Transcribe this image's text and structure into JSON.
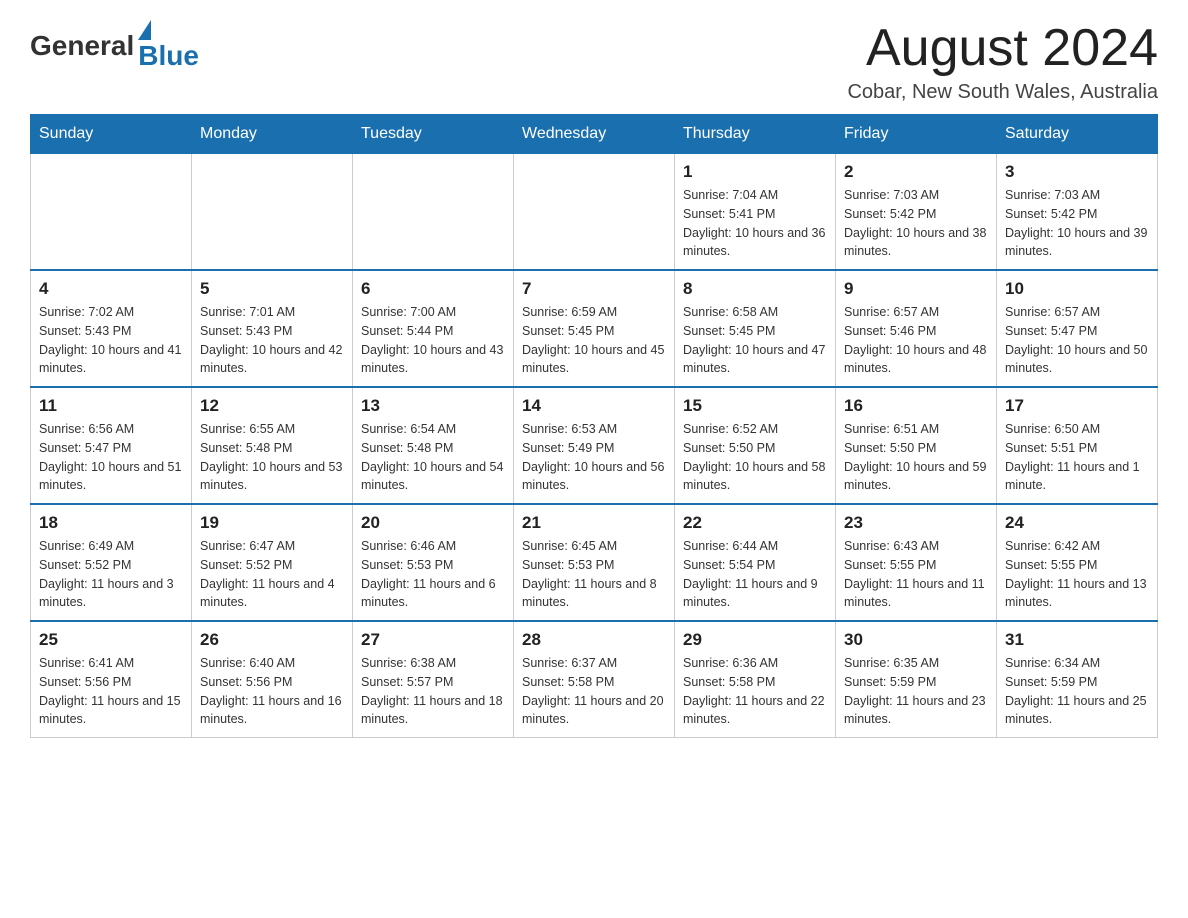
{
  "header": {
    "logo_general": "General",
    "logo_blue": "Blue",
    "month_title": "August 2024",
    "location": "Cobar, New South Wales, Australia"
  },
  "weekdays": [
    "Sunday",
    "Monday",
    "Tuesday",
    "Wednesday",
    "Thursday",
    "Friday",
    "Saturday"
  ],
  "weeks": [
    [
      {
        "day": "",
        "info": ""
      },
      {
        "day": "",
        "info": ""
      },
      {
        "day": "",
        "info": ""
      },
      {
        "day": "",
        "info": ""
      },
      {
        "day": "1",
        "info": "Sunrise: 7:04 AM\nSunset: 5:41 PM\nDaylight: 10 hours and 36 minutes."
      },
      {
        "day": "2",
        "info": "Sunrise: 7:03 AM\nSunset: 5:42 PM\nDaylight: 10 hours and 38 minutes."
      },
      {
        "day": "3",
        "info": "Sunrise: 7:03 AM\nSunset: 5:42 PM\nDaylight: 10 hours and 39 minutes."
      }
    ],
    [
      {
        "day": "4",
        "info": "Sunrise: 7:02 AM\nSunset: 5:43 PM\nDaylight: 10 hours and 41 minutes."
      },
      {
        "day": "5",
        "info": "Sunrise: 7:01 AM\nSunset: 5:43 PM\nDaylight: 10 hours and 42 minutes."
      },
      {
        "day": "6",
        "info": "Sunrise: 7:00 AM\nSunset: 5:44 PM\nDaylight: 10 hours and 43 minutes."
      },
      {
        "day": "7",
        "info": "Sunrise: 6:59 AM\nSunset: 5:45 PM\nDaylight: 10 hours and 45 minutes."
      },
      {
        "day": "8",
        "info": "Sunrise: 6:58 AM\nSunset: 5:45 PM\nDaylight: 10 hours and 47 minutes."
      },
      {
        "day": "9",
        "info": "Sunrise: 6:57 AM\nSunset: 5:46 PM\nDaylight: 10 hours and 48 minutes."
      },
      {
        "day": "10",
        "info": "Sunrise: 6:57 AM\nSunset: 5:47 PM\nDaylight: 10 hours and 50 minutes."
      }
    ],
    [
      {
        "day": "11",
        "info": "Sunrise: 6:56 AM\nSunset: 5:47 PM\nDaylight: 10 hours and 51 minutes."
      },
      {
        "day": "12",
        "info": "Sunrise: 6:55 AM\nSunset: 5:48 PM\nDaylight: 10 hours and 53 minutes."
      },
      {
        "day": "13",
        "info": "Sunrise: 6:54 AM\nSunset: 5:48 PM\nDaylight: 10 hours and 54 minutes."
      },
      {
        "day": "14",
        "info": "Sunrise: 6:53 AM\nSunset: 5:49 PM\nDaylight: 10 hours and 56 minutes."
      },
      {
        "day": "15",
        "info": "Sunrise: 6:52 AM\nSunset: 5:50 PM\nDaylight: 10 hours and 58 minutes."
      },
      {
        "day": "16",
        "info": "Sunrise: 6:51 AM\nSunset: 5:50 PM\nDaylight: 10 hours and 59 minutes."
      },
      {
        "day": "17",
        "info": "Sunrise: 6:50 AM\nSunset: 5:51 PM\nDaylight: 11 hours and 1 minute."
      }
    ],
    [
      {
        "day": "18",
        "info": "Sunrise: 6:49 AM\nSunset: 5:52 PM\nDaylight: 11 hours and 3 minutes."
      },
      {
        "day": "19",
        "info": "Sunrise: 6:47 AM\nSunset: 5:52 PM\nDaylight: 11 hours and 4 minutes."
      },
      {
        "day": "20",
        "info": "Sunrise: 6:46 AM\nSunset: 5:53 PM\nDaylight: 11 hours and 6 minutes."
      },
      {
        "day": "21",
        "info": "Sunrise: 6:45 AM\nSunset: 5:53 PM\nDaylight: 11 hours and 8 minutes."
      },
      {
        "day": "22",
        "info": "Sunrise: 6:44 AM\nSunset: 5:54 PM\nDaylight: 11 hours and 9 minutes."
      },
      {
        "day": "23",
        "info": "Sunrise: 6:43 AM\nSunset: 5:55 PM\nDaylight: 11 hours and 11 minutes."
      },
      {
        "day": "24",
        "info": "Sunrise: 6:42 AM\nSunset: 5:55 PM\nDaylight: 11 hours and 13 minutes."
      }
    ],
    [
      {
        "day": "25",
        "info": "Sunrise: 6:41 AM\nSunset: 5:56 PM\nDaylight: 11 hours and 15 minutes."
      },
      {
        "day": "26",
        "info": "Sunrise: 6:40 AM\nSunset: 5:56 PM\nDaylight: 11 hours and 16 minutes."
      },
      {
        "day": "27",
        "info": "Sunrise: 6:38 AM\nSunset: 5:57 PM\nDaylight: 11 hours and 18 minutes."
      },
      {
        "day": "28",
        "info": "Sunrise: 6:37 AM\nSunset: 5:58 PM\nDaylight: 11 hours and 20 minutes."
      },
      {
        "day": "29",
        "info": "Sunrise: 6:36 AM\nSunset: 5:58 PM\nDaylight: 11 hours and 22 minutes."
      },
      {
        "day": "30",
        "info": "Sunrise: 6:35 AM\nSunset: 5:59 PM\nDaylight: 11 hours and 23 minutes."
      },
      {
        "day": "31",
        "info": "Sunrise: 6:34 AM\nSunset: 5:59 PM\nDaylight: 11 hours and 25 minutes."
      }
    ]
  ]
}
